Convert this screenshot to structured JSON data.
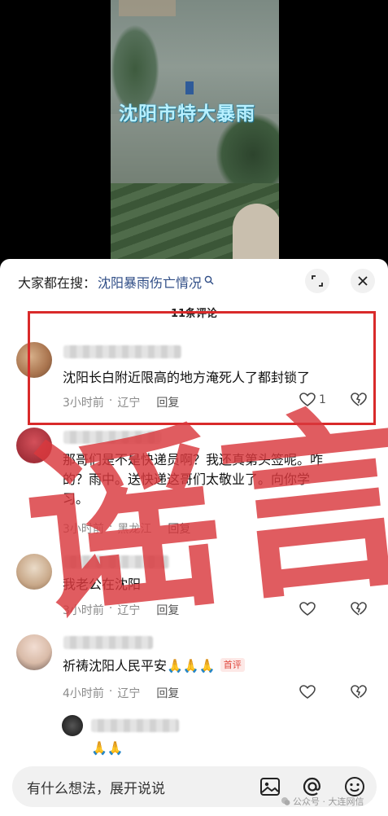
{
  "video": {
    "caption": "沈阳市特大暴雨"
  },
  "panel": {
    "search_prefix": "大家都在搜：",
    "search_term": "沈阳暴雨伤亡情况",
    "comment_count": "11条评论"
  },
  "comments": [
    {
      "text": "沈阳长白附近限高的地方淹死人了都封锁了",
      "time": "3小时前",
      "location": "辽宁",
      "reply": "回复",
      "likes": "1"
    },
    {
      "text_line1": "那哥们是不是快递员啊？我还真第头签呢。咋",
      "text_line2": "的？雨中。送快递这哥们太敬业了。向你学",
      "text_line3": "习。",
      "time": "3小时前",
      "location": "黑龙江",
      "reply": "回复"
    },
    {
      "text": "我老公在沈阳",
      "time": "3小时前",
      "location": "辽宁",
      "reply": "回复"
    },
    {
      "text": "祈祷沈阳人民平安🙏🙏🙏",
      "badge": "首评",
      "time": "4小时前",
      "location": "辽宁",
      "reply": "回复"
    },
    {
      "text": "🙏🙏"
    }
  ],
  "input": {
    "placeholder": "有什么想法，展开说说"
  },
  "stamp": {
    "text": "谣言"
  },
  "watermark": {
    "text": "公众号 · 大连网信"
  },
  "colors": {
    "accent_blue": "#2f4d86",
    "stamp_red": "#d9383d",
    "box_red": "#d92a2a"
  }
}
